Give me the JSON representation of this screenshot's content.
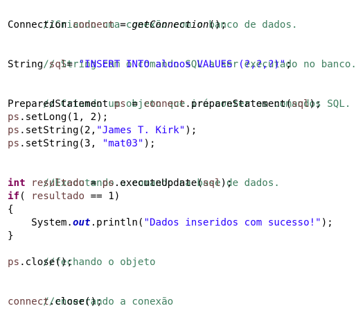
{
  "code": {
    "comment_connection": "//Criando uma conexão com o banco de dados.",
    "type_connection": "Connection",
    "var_connect": "connect",
    "op_assign": " = ",
    "method_getConnection": "getConnection",
    "paren_semicolon": "();",
    "comment_sql": "// String com o comando SQL a ser executado no banco.",
    "type_string": "String",
    "var_sql": "sql",
    "op_eq_nospace": "= ",
    "sql_string": "\"INSERT INTO alunos VALUES (?,?,?)\"",
    "semicolon": ";",
    "comment_prepared": "// Criando um objeto que irá conter os comandos SQL.",
    "type_prepared": "PreparedStatement",
    "var_ps": "ps",
    "connect_call": "connect",
    "prepare_call": ".prepareStatement(",
    "sql_arg": "sql",
    "close_paren_semi": ");",
    "setlong_line": ".setLong(1, 2);",
    "setstring_prefix_1": ".setString(2,",
    "string_name": "\"James T. Kirk\"",
    "setstring_prefix_2": ".setString(3, ",
    "string_mat": "\"mat03\"",
    "comment_execute": "//Executando o comando na base de dados.",
    "kw_int": "int",
    "var_resultado": "resultado",
    "execute_call": ".executeUpdate(",
    "kw_if": "if",
    "if_open": "( ",
    "if_cond": " == 1)",
    "brace_open": "{",
    "system": "System.",
    "out": "out",
    "println": ".println(",
    "success_string": "\"Dados inseridos com sucesso!\"",
    "brace_close": "}",
    "comment_close_obj": "//fechando o objeto",
    "ps_close": ".close();",
    "comment_close_conn": "//encerrando a conexão",
    "connect_close": ".close();"
  }
}
